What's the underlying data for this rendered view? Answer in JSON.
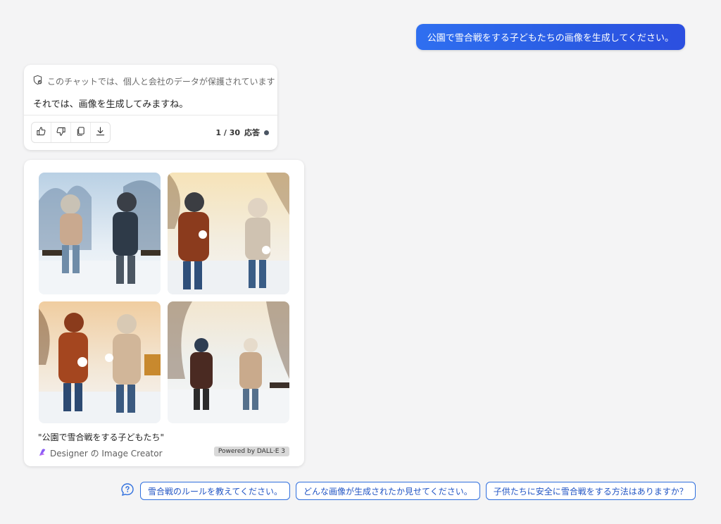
{
  "user_message": "公園で雪合戦をする子どもたちの画像を生成してください。",
  "bot_message": {
    "privacy_notice": "このチャットでは、個人と会社のデータが保護されています",
    "reply": "それでは、画像を生成してみますね。",
    "counter_value": "1 / 30",
    "counter_label": "応答"
  },
  "image_result": {
    "caption": "\"公園で雪合戦をする子どもたち\"",
    "credit_text": "Designer の Image Creator",
    "powered_by": "Powered by DALL·E 3"
  },
  "suggestions": [
    "雪合戦のルールを教えてください。",
    "どんな画像が生成されたか見せてください。",
    "子供たちに安全に雪合戦をする方法はありますか？"
  ],
  "icons": {
    "privacy": "shield-check-icon",
    "like": "thumbs-up-icon",
    "dislike": "thumbs-down-icon",
    "copy": "copy-icon",
    "download": "download-icon",
    "designer": "designer-logo-icon",
    "help": "question-bubble-icon"
  },
  "colors": {
    "accent": "#2f6fde",
    "user_bubble": "#2f5fe6",
    "background": "#f4f4f5"
  }
}
